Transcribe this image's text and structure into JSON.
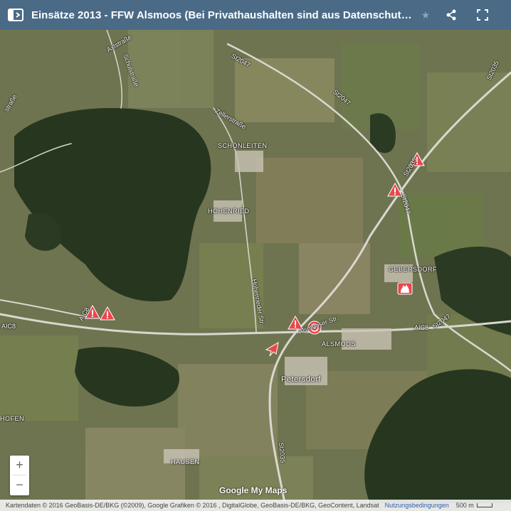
{
  "header": {
    "title": "Einsätze 2013 - FFW Alsmoos (Bei Privathaushalten sind aus Datenschutzgründen...",
    "menu_icon": "sidebar-toggle-icon",
    "star_icon": "star-icon",
    "share_icon": "share-icon",
    "fullscreen_icon": "fullscreen-icon"
  },
  "places": {
    "schoenleiten": "SCHÖNLEITEN",
    "hohenried": "HOHENRIED",
    "gebersdorf": "GEBERSDORF",
    "alsmoos": "ALSMOOS",
    "petersdorf": "Petersdorf",
    "hausen": "HAUSEN",
    "hofen": "HOFEN"
  },
  "roads": {
    "axtstrasse": "Axtstraße",
    "schulstrasse": "Schulstraße",
    "zellerstrasse": "Zellerstraße",
    "st2047_top": "St2047",
    "st2047_mid": "St2047",
    "st2047_right": "St2047",
    "st2047_east": "St2047",
    "st2035_top": "St2035",
    "st2035_mid": "St2035",
    "st2035_south": "St2035",
    "aic8_west": "AIC8",
    "aic8_east": "AIC8",
    "aic8_left": "AIC8",
    "hohenrieder": "Hohenrieder Str.",
    "alsmooser": "Alsmooser Str.",
    "strasse_left": "straße"
  },
  "controls": {
    "zoom_in": "+",
    "zoom_out": "−"
  },
  "logo": "Google My Maps",
  "footer": {
    "attribution": "Kartendaten © 2016 GeoBasis-DE/BKG (©2009), Google Grafiken © 2016 , DigitalGlobe, GeoBasis-DE/BKG, GeoContent, Landsat",
    "terms": "Nutzungsbedingungen",
    "scale": "500 m"
  },
  "colors": {
    "header_bg": "#4a6a86",
    "marker_red": "#e8474c",
    "road": "#d8d8d0"
  }
}
